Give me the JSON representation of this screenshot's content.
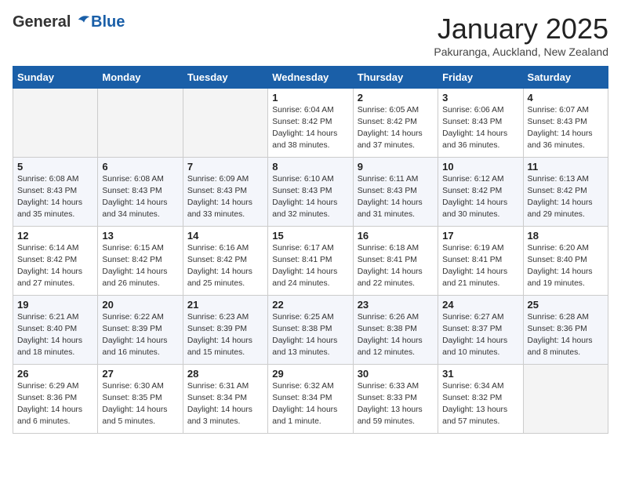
{
  "header": {
    "logo_general": "General",
    "logo_blue": "Blue",
    "month": "January 2025",
    "location": "Pakuranga, Auckland, New Zealand"
  },
  "days_of_week": [
    "Sunday",
    "Monday",
    "Tuesday",
    "Wednesday",
    "Thursday",
    "Friday",
    "Saturday"
  ],
  "weeks": [
    [
      {
        "day": null
      },
      {
        "day": null
      },
      {
        "day": null
      },
      {
        "day": "1",
        "info": "Sunrise: 6:04 AM\nSunset: 8:42 PM\nDaylight: 14 hours\nand 38 minutes."
      },
      {
        "day": "2",
        "info": "Sunrise: 6:05 AM\nSunset: 8:42 PM\nDaylight: 14 hours\nand 37 minutes."
      },
      {
        "day": "3",
        "info": "Sunrise: 6:06 AM\nSunset: 8:43 PM\nDaylight: 14 hours\nand 36 minutes."
      },
      {
        "day": "4",
        "info": "Sunrise: 6:07 AM\nSunset: 8:43 PM\nDaylight: 14 hours\nand 36 minutes."
      }
    ],
    [
      {
        "day": "5",
        "info": "Sunrise: 6:08 AM\nSunset: 8:43 PM\nDaylight: 14 hours\nand 35 minutes."
      },
      {
        "day": "6",
        "info": "Sunrise: 6:08 AM\nSunset: 8:43 PM\nDaylight: 14 hours\nand 34 minutes."
      },
      {
        "day": "7",
        "info": "Sunrise: 6:09 AM\nSunset: 8:43 PM\nDaylight: 14 hours\nand 33 minutes."
      },
      {
        "day": "8",
        "info": "Sunrise: 6:10 AM\nSunset: 8:43 PM\nDaylight: 14 hours\nand 32 minutes."
      },
      {
        "day": "9",
        "info": "Sunrise: 6:11 AM\nSunset: 8:43 PM\nDaylight: 14 hours\nand 31 minutes."
      },
      {
        "day": "10",
        "info": "Sunrise: 6:12 AM\nSunset: 8:42 PM\nDaylight: 14 hours\nand 30 minutes."
      },
      {
        "day": "11",
        "info": "Sunrise: 6:13 AM\nSunset: 8:42 PM\nDaylight: 14 hours\nand 29 minutes."
      }
    ],
    [
      {
        "day": "12",
        "info": "Sunrise: 6:14 AM\nSunset: 8:42 PM\nDaylight: 14 hours\nand 27 minutes."
      },
      {
        "day": "13",
        "info": "Sunrise: 6:15 AM\nSunset: 8:42 PM\nDaylight: 14 hours\nand 26 minutes."
      },
      {
        "day": "14",
        "info": "Sunrise: 6:16 AM\nSunset: 8:42 PM\nDaylight: 14 hours\nand 25 minutes."
      },
      {
        "day": "15",
        "info": "Sunrise: 6:17 AM\nSunset: 8:41 PM\nDaylight: 14 hours\nand 24 minutes."
      },
      {
        "day": "16",
        "info": "Sunrise: 6:18 AM\nSunset: 8:41 PM\nDaylight: 14 hours\nand 22 minutes."
      },
      {
        "day": "17",
        "info": "Sunrise: 6:19 AM\nSunset: 8:41 PM\nDaylight: 14 hours\nand 21 minutes."
      },
      {
        "day": "18",
        "info": "Sunrise: 6:20 AM\nSunset: 8:40 PM\nDaylight: 14 hours\nand 19 minutes."
      }
    ],
    [
      {
        "day": "19",
        "info": "Sunrise: 6:21 AM\nSunset: 8:40 PM\nDaylight: 14 hours\nand 18 minutes."
      },
      {
        "day": "20",
        "info": "Sunrise: 6:22 AM\nSunset: 8:39 PM\nDaylight: 14 hours\nand 16 minutes."
      },
      {
        "day": "21",
        "info": "Sunrise: 6:23 AM\nSunset: 8:39 PM\nDaylight: 14 hours\nand 15 minutes."
      },
      {
        "day": "22",
        "info": "Sunrise: 6:25 AM\nSunset: 8:38 PM\nDaylight: 14 hours\nand 13 minutes."
      },
      {
        "day": "23",
        "info": "Sunrise: 6:26 AM\nSunset: 8:38 PM\nDaylight: 14 hours\nand 12 minutes."
      },
      {
        "day": "24",
        "info": "Sunrise: 6:27 AM\nSunset: 8:37 PM\nDaylight: 14 hours\nand 10 minutes."
      },
      {
        "day": "25",
        "info": "Sunrise: 6:28 AM\nSunset: 8:36 PM\nDaylight: 14 hours\nand 8 minutes."
      }
    ],
    [
      {
        "day": "26",
        "info": "Sunrise: 6:29 AM\nSunset: 8:36 PM\nDaylight: 14 hours\nand 6 minutes."
      },
      {
        "day": "27",
        "info": "Sunrise: 6:30 AM\nSunset: 8:35 PM\nDaylight: 14 hours\nand 5 minutes."
      },
      {
        "day": "28",
        "info": "Sunrise: 6:31 AM\nSunset: 8:34 PM\nDaylight: 14 hours\nand 3 minutes."
      },
      {
        "day": "29",
        "info": "Sunrise: 6:32 AM\nSunset: 8:34 PM\nDaylight: 14 hours\nand 1 minute."
      },
      {
        "day": "30",
        "info": "Sunrise: 6:33 AM\nSunset: 8:33 PM\nDaylight: 13 hours\nand 59 minutes."
      },
      {
        "day": "31",
        "info": "Sunrise: 6:34 AM\nSunset: 8:32 PM\nDaylight: 13 hours\nand 57 minutes."
      },
      {
        "day": null
      }
    ]
  ]
}
